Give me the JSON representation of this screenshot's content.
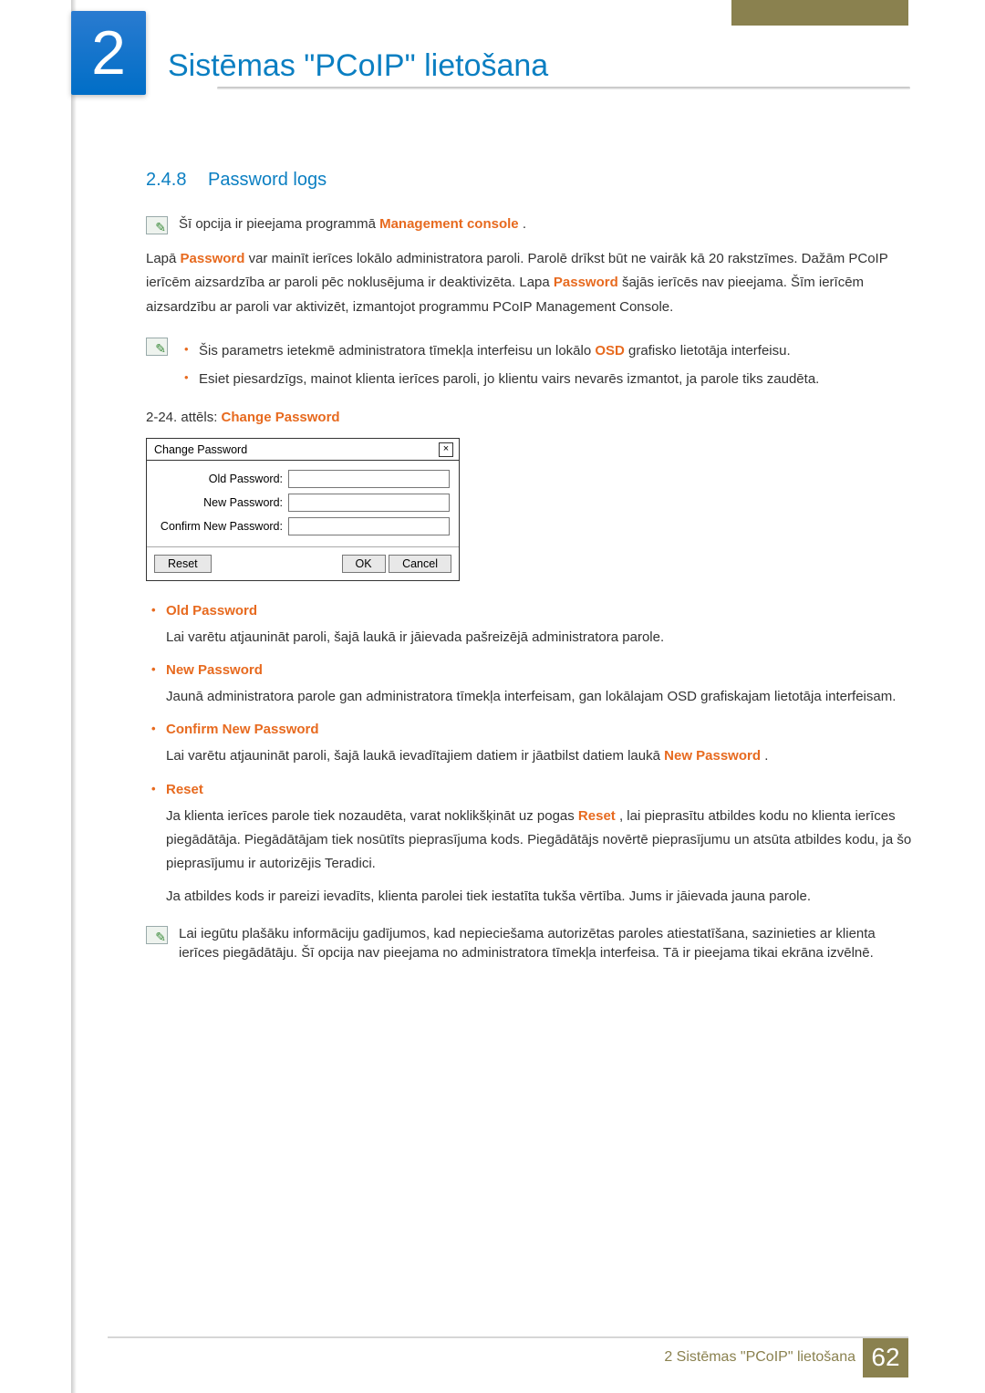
{
  "chapter": {
    "number": "2",
    "title": "Sistēmas \"PCoIP\" lietošana"
  },
  "section": {
    "number": "2.4.8",
    "title": "Password logs"
  },
  "note1_prefix": "Šī opcija ir pieejama programmā ",
  "note1_link": "Management console",
  "note1_suffix": ".",
  "para_main": {
    "a": "Lapā ",
    "pw1": "Password",
    "b": " var mainīt ierīces lokālo administratora paroli. Parolē drīkst būt ne vairāk kā 20 rakstzīmes. Dažām PCoIP ierīcēm aizsardzība ar paroli pēc noklusējuma ir deaktivizēta. Lapa ",
    "pw2": "Password",
    "c": " šajās ierīcēs nav pieejama. Šīm ierīcēm aizsardzību ar paroli var aktivizēt, izmantojot programmu PCoIP Management Console."
  },
  "note2_bullets": [
    {
      "a": "Šis parametrs ietekmē administratora tīmekļa interfeisu un lokālo ",
      "term": "OSD",
      "b": " grafisko lietotāja interfeisu."
    },
    {
      "text": "Esiet piesardzīgs, mainot klienta ierīces paroli, jo klientu vairs nevarēs izmantot, ja parole tiks zaudēta."
    }
  ],
  "figure": {
    "label_a": "2-24. attēls: ",
    "label_b": "Change Password"
  },
  "dialog": {
    "title": "Change Password",
    "close": "×",
    "fields": {
      "old": "Old Password:",
      "new": "New Password:",
      "confirm": "Confirm New Password:"
    },
    "buttons": {
      "reset": "Reset",
      "ok": "OK",
      "cancel": "Cancel"
    }
  },
  "items": [
    {
      "title": "Old Password",
      "desc_a": "Lai varētu atjaunināt paroli, šajā laukā ir jāievada pašreizējā administratora parole."
    },
    {
      "title": "New Password",
      "desc_a": "Jaunā administratora parole gan administratora tīmekļa interfeisam, gan lokālajam OSD grafiskajam lietotāja interfeisam."
    },
    {
      "title": "Confirm New Password",
      "desc_a": "Lai varētu atjaunināt paroli, šajā laukā ievadītajiem datiem ir jāatbilst datiem laukā ",
      "term": "New Password",
      "desc_b": "."
    },
    {
      "title": "Reset",
      "desc_a": "Ja klienta ierīces parole tiek nozaudēta, varat noklikšķināt uz pogas ",
      "term": "Reset",
      "desc_b": ", lai pieprasītu atbildes kodu no klienta ierīces piegādātāja. Piegādātājam tiek nosūtīts pieprasījuma kods. Piegādātājs novērtē pieprasījumu un atsūta atbildes kodu, ja šo pieprasījumu ir autorizējis Teradici.",
      "desc_c": "Ja atbildes kods ir pareizi ievadīts, klienta parolei tiek iestatīta tukša vērtība. Jums ir jāievada jauna parole."
    }
  ],
  "note3": "Lai iegūtu plašāku informāciju gadījumos, kad nepieciešama autorizētas paroles atiestatīšana, sazinieties ar klienta ierīces piegādātāju. Šī opcija nav pieejama no administratora tīmekļa interfeisa. Tā ir pieejama tikai ekrāna izvēlnē.",
  "footer": {
    "prefix": "2 Sistēmas \"PCoIP\" lietošana",
    "page": "62"
  }
}
